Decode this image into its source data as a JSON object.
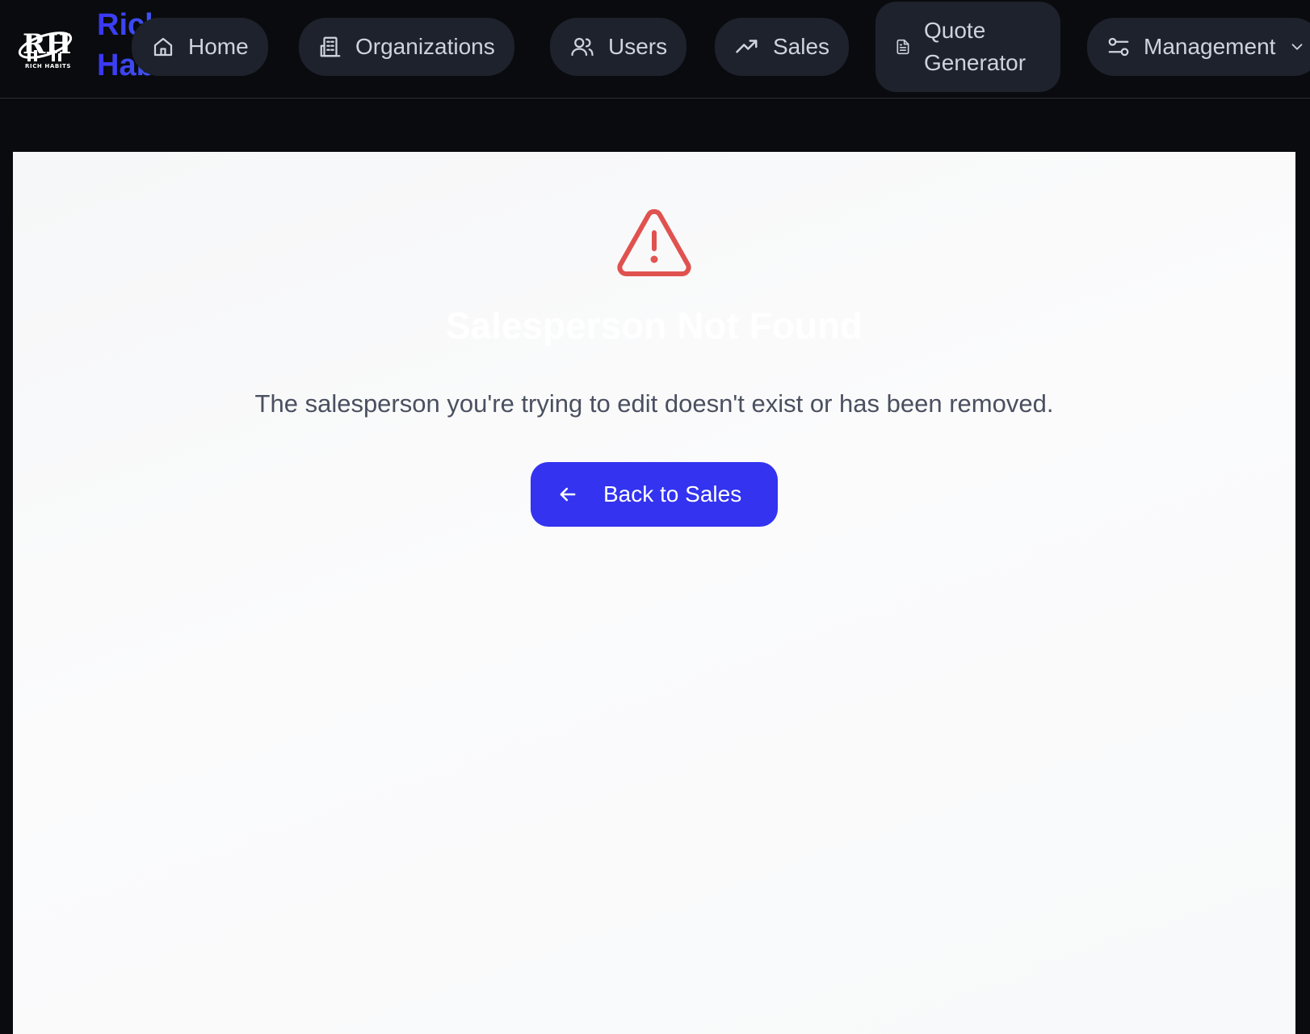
{
  "brand": {
    "name": "Rich\nHabits",
    "logo_caption": "RICH HABITS"
  },
  "nav": {
    "items": [
      {
        "label": "Home",
        "icon": "home-icon"
      },
      {
        "label": "Organizations",
        "icon": "building-icon"
      },
      {
        "label": "Users",
        "icon": "users-icon"
      },
      {
        "label": "Sales",
        "icon": "trending-up-icon"
      },
      {
        "label": "Quote\nGenerator",
        "icon": "document-icon"
      },
      {
        "label": "Management",
        "icon": "sliders-icon"
      }
    ]
  },
  "main": {
    "icon": "alert-triangle-icon",
    "title": "Salesperson Not Found",
    "message": "The salesperson you're trying to edit doesn't exist or has been removed.",
    "back_button": "Back to Sales"
  },
  "colors": {
    "accent": "#3333f0",
    "warning": "#e0524f",
    "nav_bg": "#1d222c",
    "page_bg": "#0a0b0e"
  }
}
